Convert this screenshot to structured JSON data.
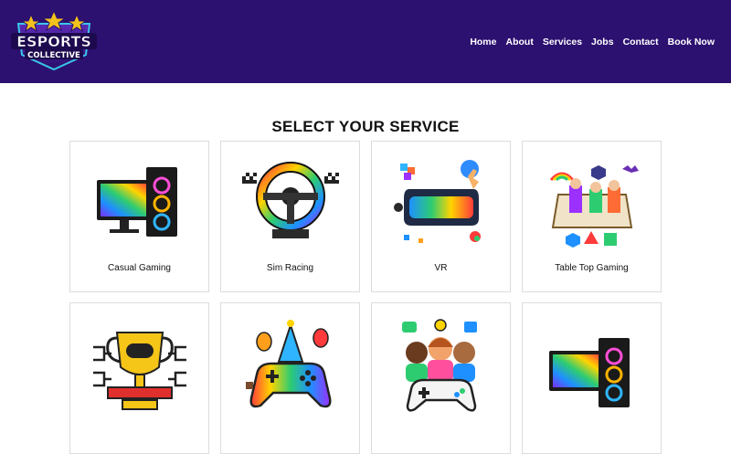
{
  "brand": {
    "line1": "ESPORTS",
    "line2": "COLLECTIVE"
  },
  "nav": [
    "Home",
    "About",
    "Services",
    "Jobs",
    "Contact",
    "Book Now"
  ],
  "page_title": "SELECT YOUR SERVICE",
  "services": [
    {
      "label": "Casual Gaming",
      "icon": "gaming-pc-icon"
    },
    {
      "label": "Sim Racing",
      "icon": "racing-wheel-icon"
    },
    {
      "label": "VR",
      "icon": "vr-headset-icon"
    },
    {
      "label": "Table Top Gaming",
      "icon": "tabletop-game-icon"
    },
    {
      "label": "",
      "icon": "trophy-icon"
    },
    {
      "label": "",
      "icon": "party-controller-icon"
    },
    {
      "label": "",
      "icon": "community-controller-icon"
    },
    {
      "label": "",
      "icon": "gaming-pc-icon"
    }
  ],
  "colors": {
    "header": "#2c1170",
    "text": "#111111"
  }
}
